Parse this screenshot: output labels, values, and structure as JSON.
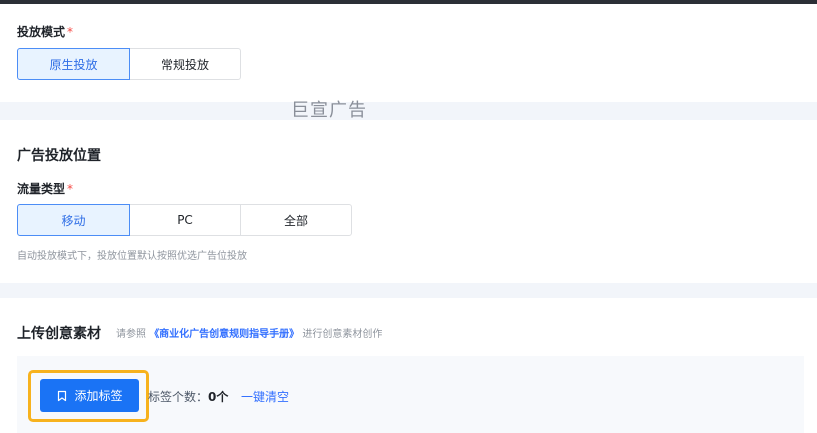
{
  "delivery_mode": {
    "label": "投放模式",
    "required_mark": "*",
    "options": [
      "原生投放",
      "常规投放"
    ],
    "selected": "原生投放"
  },
  "watermark": "巨宣广告",
  "placement": {
    "section_title": "广告投放位置",
    "traffic_label": "流量类型",
    "required_mark": "*",
    "options": [
      "移动",
      "PC",
      "全部"
    ],
    "selected": "移动",
    "hint": "自动投放模式下，投放位置默认按照优选广告位投放"
  },
  "upload": {
    "title": "上传创意素材",
    "hint_prefix": "请参照",
    "hint_link": "《商业化广告创意规则指导手册》",
    "hint_suffix": "进行创意素材创作",
    "add_tag_label": "添加标签",
    "tag_count_label": "标签个数：",
    "tag_count": "0个",
    "clear_label": "一键清空"
  },
  "colors": {
    "accent": "#1a73f5",
    "highlight": "#f7b21d",
    "required": "#f54a45"
  }
}
